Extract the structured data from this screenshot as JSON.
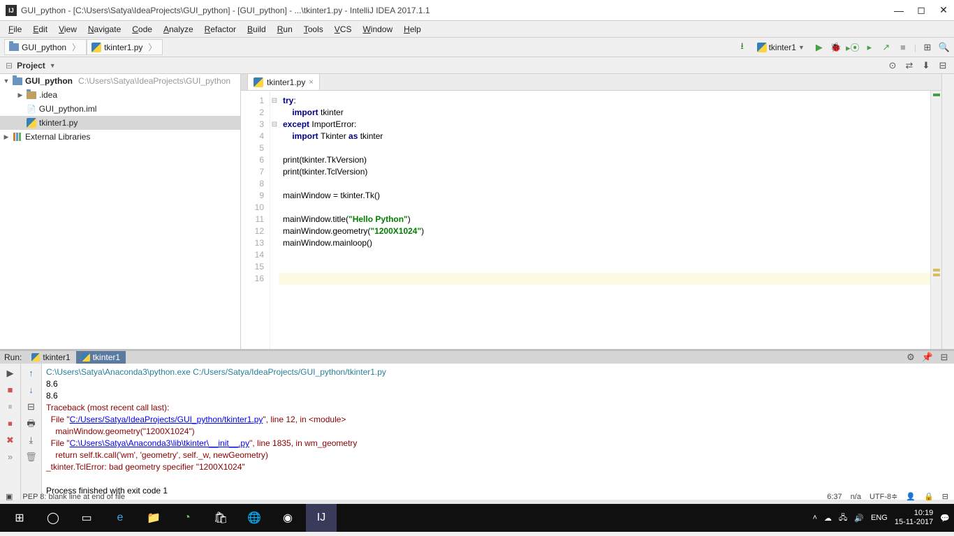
{
  "window": {
    "title": "GUI_python - [C:\\Users\\Satya\\IdeaProjects\\GUI_python] - [GUI_python] - ...\\tkinter1.py - IntelliJ IDEA 2017.1.1"
  },
  "menu": [
    "File",
    "Edit",
    "View",
    "Navigate",
    "Code",
    "Analyze",
    "Refactor",
    "Build",
    "Run",
    "Tools",
    "VCS",
    "Window",
    "Help"
  ],
  "breadcrumbs": [
    {
      "icon": "folder",
      "label": "GUI_python"
    },
    {
      "icon": "python",
      "label": "tkinter1.py"
    }
  ],
  "run_config": {
    "label": "tkinter1"
  },
  "project": {
    "header": "Project",
    "root": {
      "label": "GUI_python",
      "path": "C:\\Users\\Satya\\IdeaProjects\\GUI_python"
    },
    "nodes": [
      {
        "indent": 1,
        "icon": "folder",
        "label": ".idea",
        "expandable": true
      },
      {
        "indent": 1,
        "icon": "file",
        "label": "GUI_python.iml"
      },
      {
        "indent": 1,
        "icon": "python",
        "label": "tkinter1.py",
        "selected": true
      }
    ],
    "external": "External Libraries"
  },
  "editor": {
    "tab": "tkinter1.py",
    "lines": [
      {
        "n": 1,
        "tokens": [
          {
            "t": "kw",
            "v": "try"
          },
          {
            "t": "id",
            "v": ":"
          }
        ]
      },
      {
        "n": 2,
        "tokens": [
          {
            "t": "id",
            "v": "    "
          },
          {
            "t": "kw",
            "v": "import "
          },
          {
            "t": "id",
            "v": "tkinter"
          }
        ]
      },
      {
        "n": 3,
        "tokens": [
          {
            "t": "kw",
            "v": "except "
          },
          {
            "t": "id",
            "v": "ImportError:"
          }
        ]
      },
      {
        "n": 4,
        "tokens": [
          {
            "t": "id",
            "v": "    "
          },
          {
            "t": "kw",
            "v": "import "
          },
          {
            "t": "id",
            "v": "Tkinter "
          },
          {
            "t": "kw",
            "v": "as "
          },
          {
            "t": "id",
            "v": "tkinter"
          }
        ]
      },
      {
        "n": 5,
        "tokens": []
      },
      {
        "n": 6,
        "tokens": [
          {
            "t": "id",
            "v": "print(tkinter.TkVersion)"
          }
        ]
      },
      {
        "n": 7,
        "tokens": [
          {
            "t": "id",
            "v": "print(tkinter.TclVersion)"
          }
        ]
      },
      {
        "n": 8,
        "tokens": []
      },
      {
        "n": 9,
        "tokens": [
          {
            "t": "id",
            "v": "mainWindow = tkinter.Tk()"
          }
        ]
      },
      {
        "n": 10,
        "tokens": []
      },
      {
        "n": 11,
        "tokens": [
          {
            "t": "id",
            "v": "mainWindow.title("
          },
          {
            "t": "str",
            "v": "\"Hello Python\""
          },
          {
            "t": "id",
            "v": ")"
          }
        ]
      },
      {
        "n": 12,
        "tokens": [
          {
            "t": "id",
            "v": "mainWindow.geometry("
          },
          {
            "t": "str",
            "v": "\"1200X1024\""
          },
          {
            "t": "id",
            "v": ")"
          }
        ]
      },
      {
        "n": 13,
        "tokens": [
          {
            "t": "id",
            "v": "mainWindow.mainloop()"
          }
        ]
      },
      {
        "n": 14,
        "tokens": []
      },
      {
        "n": 15,
        "tokens": []
      },
      {
        "n": 16,
        "tokens": []
      }
    ],
    "current_line": 16
  },
  "run": {
    "header": "Run:",
    "tabs": [
      "tkinter1",
      "tkinter1"
    ],
    "active_tab": 1,
    "output": [
      {
        "cls": "path",
        "text": "C:\\Users\\Satya\\Anaconda3\\python.exe C:/Users/Satya/IdeaProjects/GUI_python/tkinter1.py"
      },
      {
        "cls": "in",
        "text": "8.6"
      },
      {
        "cls": "in",
        "text": "8.6"
      },
      {
        "cls": "err",
        "text": "Traceback (most recent call last):"
      },
      {
        "cls": "err",
        "text": "  File \"",
        "link": "C:/Users/Satya/IdeaProjects/GUI_python/tkinter1.py",
        "tail": "\", line 12, in <module>"
      },
      {
        "cls": "err",
        "text": "    mainWindow.geometry(\"1200X1024\")"
      },
      {
        "cls": "err",
        "text": "  File \"",
        "link": "C:\\Users\\Satya\\Anaconda3\\lib\\tkinter\\__init__.py",
        "tail": "\", line 1835, in wm_geometry"
      },
      {
        "cls": "err",
        "text": "    return self.tk.call('wm', 'geometry', self._w, newGeometry)"
      },
      {
        "cls": "err",
        "text": "_tkinter.TclError: bad geometry specifier \"1200X1024\""
      },
      {
        "cls": "in",
        "text": ""
      },
      {
        "cls": "in",
        "text": "Process finished with exit code 1"
      }
    ]
  },
  "status": {
    "msg": "PEP 8: blank line at end of file",
    "pos": "6:37",
    "readonly": "n/a",
    "encoding": "UTF-8"
  },
  "tray": {
    "lang": "ENG",
    "time": "10:19",
    "date": "15-11-2017"
  }
}
